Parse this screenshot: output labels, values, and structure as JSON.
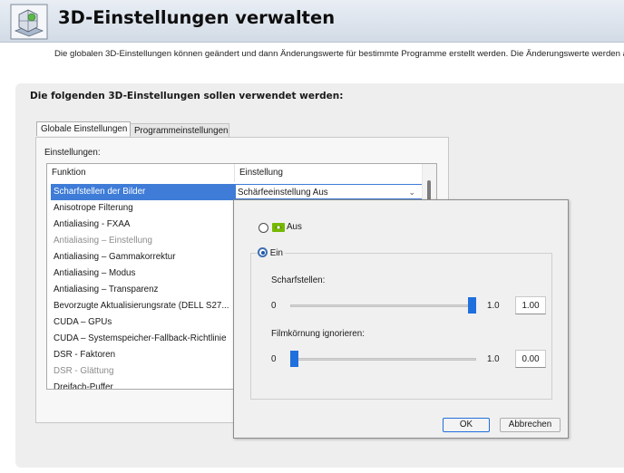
{
  "header": {
    "title": "3D-Einstellungen verwalten",
    "description": "Die globalen 3D-Einstellungen können geändert und dann Änderungswerte für bestimmte Programme erstellt werden. Die Änderungswerte werden a"
  },
  "main": {
    "section_title": "Die folgenden 3D-Einstellungen sollen verwendet werden:",
    "tabs": [
      {
        "label": "Globale Einstellungen",
        "active": true
      },
      {
        "label": "Programmeinstellungen",
        "active": false
      }
    ],
    "settings_label": "Einstellungen:",
    "table": {
      "columns": [
        "Funktion",
        "Einstellung"
      ],
      "rows": [
        {
          "label": "Scharfstellen der Bilder",
          "selected": true,
          "disabled": false
        },
        {
          "label": "Anisotrope Filterung",
          "disabled": false
        },
        {
          "label": "Antialiasing - FXAA",
          "disabled": false
        },
        {
          "label": "Antialiasing – Einstellung",
          "disabled": true
        },
        {
          "label": "Antialiasing – Gammakorrektur",
          "disabled": false
        },
        {
          "label": "Antialiasing – Modus",
          "disabled": false
        },
        {
          "label": "Antialiasing – Transparenz",
          "disabled": false
        },
        {
          "label": "Bevorzugte Aktualisierungsrate (DELL S27...",
          "disabled": false
        },
        {
          "label": "CUDA – GPUs",
          "disabled": false
        },
        {
          "label": "CUDA – Systemspeicher-Fallback-Richtlinie",
          "disabled": false
        },
        {
          "label": "DSR - Faktoren",
          "disabled": false
        },
        {
          "label": "DSR - Glättung",
          "disabled": true
        },
        {
          "label": "Dreifach-Puffer",
          "disabled": false
        }
      ],
      "selected_value": "Schärfeeinstellung Aus"
    }
  },
  "popup": {
    "option_off": "Aus",
    "option_on": "Ein",
    "selected_option": "Ein",
    "off_icon": "nvidia-logo-icon",
    "sharpen": {
      "label": "Scharfstellen:",
      "min": "0",
      "max": "1.0",
      "value": "1.00",
      "fraction": 1.0
    },
    "grain": {
      "label": "Filmkörnung ignorieren:",
      "min": "0",
      "max": "1.0",
      "value": "0.00",
      "fraction": 0.0
    },
    "ok_label": "OK",
    "cancel_label": "Abbrechen"
  },
  "colors": {
    "accent": "#1f6fdc",
    "selection": "#3e7cd7",
    "nvidia_green": "#76b900"
  }
}
